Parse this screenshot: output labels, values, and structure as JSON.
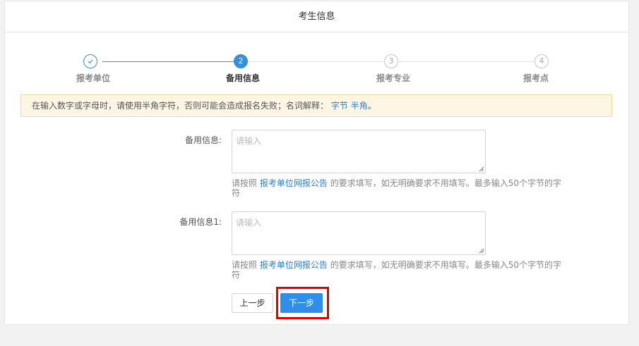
{
  "header": {
    "title": "考生信息"
  },
  "steps": [
    {
      "number": "✓",
      "label": "报考单位",
      "state": "done"
    },
    {
      "number": "2",
      "label": "备用信息",
      "state": "active"
    },
    {
      "number": "3",
      "label": "报考专业",
      "state": "todo"
    },
    {
      "number": "4",
      "label": "报考点",
      "state": "todo"
    }
  ],
  "notice": {
    "text": "在输入数字或字母时，请使用半角字符，否则可能会造成报名失败；名词解释：",
    "link1": "字节",
    "link2": "半角",
    "end": "。"
  },
  "fields": [
    {
      "label": "备用信息:",
      "placeholder": "请输入",
      "help_prefix": "请按照",
      "help_link": "报考单位网报公告",
      "help_suffix": "的要求填写，如无明确要求不用填写。最多输入50个字节的字符"
    },
    {
      "label": "备用信息1:",
      "placeholder": "请输入",
      "help_prefix": "请按照",
      "help_link": "报考单位网报公告",
      "help_suffix": "的要求填写，如无明确要求不用填写。最多输入50个字节的字符"
    }
  ],
  "buttons": {
    "prev": "上一步",
    "next": "下一步"
  },
  "colors": {
    "primary": "#2f8fe8",
    "notice_bg": "#fdf6e4",
    "highlight": "#e00000"
  }
}
